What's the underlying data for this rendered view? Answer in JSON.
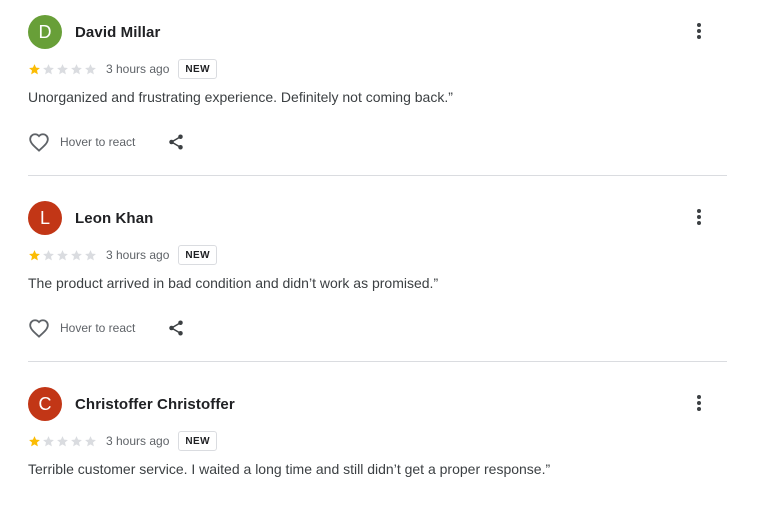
{
  "reviews": [
    {
      "initial": "D",
      "avatar_color": "#689f38",
      "name": "David Millar",
      "rating": 1,
      "max_rating": 5,
      "time": "3 hours ago",
      "badge": "NEW",
      "text": "Unorganized and frustrating experience. Definitely not coming back.”",
      "react_label": "Hover to react",
      "show_actions": true
    },
    {
      "initial": "L",
      "avatar_color": "#c23616",
      "name": "Leon Khan",
      "rating": 1,
      "max_rating": 5,
      "time": "3 hours ago",
      "badge": "NEW",
      "text": "The product arrived in bad condition and didn’t work as promised.”",
      "react_label": "Hover to react",
      "show_actions": true
    },
    {
      "initial": "C",
      "avatar_color": "#c23616",
      "name": "Christoffer Christoffer",
      "rating": 1,
      "max_rating": 5,
      "time": "3 hours ago",
      "badge": "NEW",
      "text": "Terrible customer service. I waited a long time and still didn’t get a proper response.”",
      "react_label": "",
      "show_actions": false
    }
  ],
  "colors": {
    "star_filled": "#fbbc04",
    "star_empty": "#dadce0",
    "divider": "#dadce0"
  },
  "icons": {
    "more": "more-vert-icon",
    "react": "heart-outline-icon",
    "share": "share-icon",
    "star": "star-icon"
  }
}
